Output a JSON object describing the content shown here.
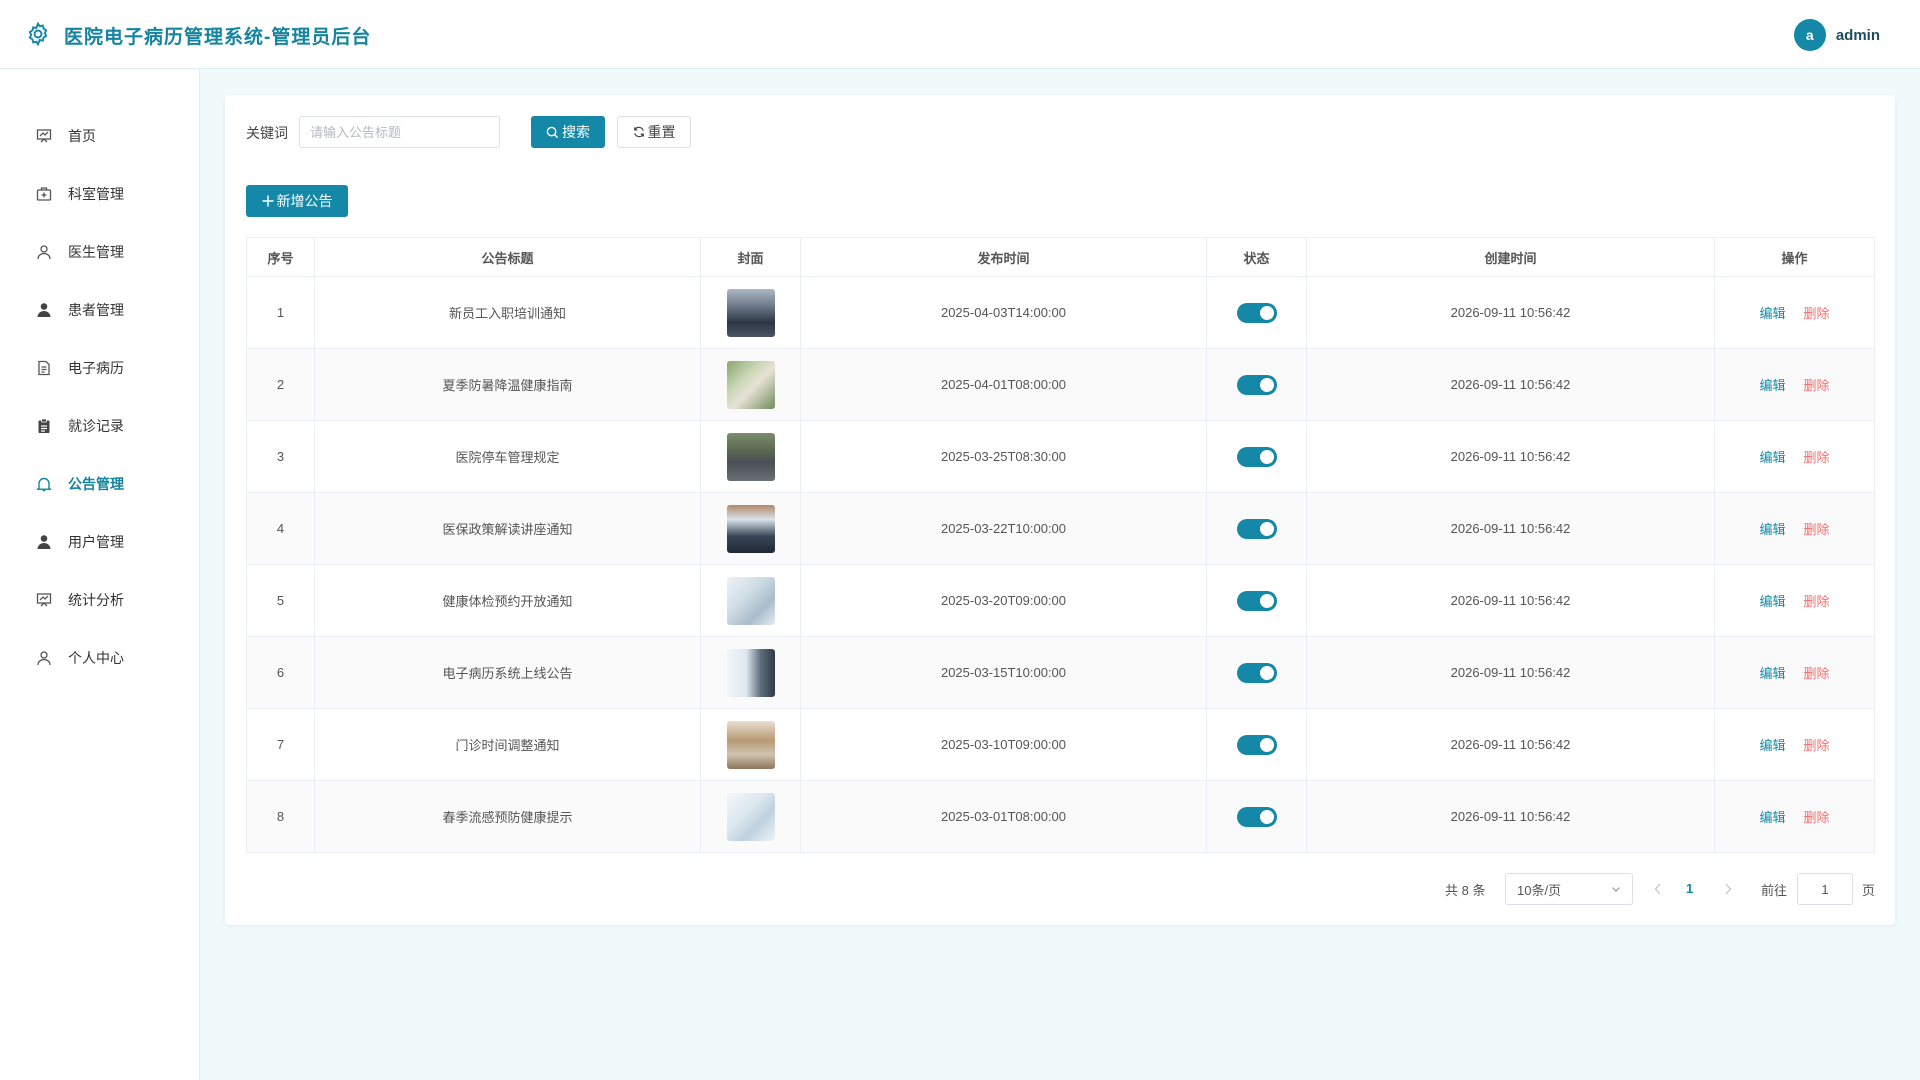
{
  "app": {
    "title": "医院电子病历管理系统-管理员后台"
  },
  "user": {
    "avatar_letter": "a",
    "name": "admin"
  },
  "colors": {
    "primary": "#1488a6",
    "danger": "#f56c6c",
    "background": "#f0fafb"
  },
  "sidebar": {
    "items": [
      {
        "label": "首页",
        "icon": "presentation-icon",
        "active": false
      },
      {
        "label": "科室管理",
        "icon": "medical-kit-icon",
        "active": false
      },
      {
        "label": "医生管理",
        "icon": "user-outline-icon",
        "active": false
      },
      {
        "label": "患者管理",
        "icon": "user-filled-icon",
        "active": false
      },
      {
        "label": "电子病历",
        "icon": "document-icon",
        "active": false
      },
      {
        "label": "就诊记录",
        "icon": "clipboard-icon",
        "active": false
      },
      {
        "label": "公告管理",
        "icon": "bell-icon",
        "active": true
      },
      {
        "label": "用户管理",
        "icon": "user-filled-icon",
        "active": false
      },
      {
        "label": "统计分析",
        "icon": "presentation-icon",
        "active": false
      },
      {
        "label": "个人中心",
        "icon": "user-outline-icon",
        "active": false
      }
    ]
  },
  "search": {
    "label": "关键词",
    "placeholder": "请输入公告标题",
    "value": "",
    "search_label": "搜索",
    "reset_label": "重置"
  },
  "toolbar": {
    "add_label": "新增公告"
  },
  "table": {
    "columns": [
      "序号",
      "公告标题",
      "封面",
      "发布时间",
      "状态",
      "创建时间",
      "操作"
    ],
    "edit_label": "编辑",
    "delete_label": "删除",
    "rows": [
      {
        "index": "1",
        "title": "新员工入职培训通知",
        "cover": "training-room-photo",
        "publish_time": "2025-04-03T14:00:00",
        "enabled": true,
        "created": "2026-09-11 10:56:42"
      },
      {
        "index": "2",
        "title": "夏季防暑降温健康指南",
        "cover": "summer-drinking-photo",
        "publish_time": "2025-04-01T08:00:00",
        "enabled": true,
        "created": "2026-09-11 10:56:42"
      },
      {
        "index": "3",
        "title": "医院停车管理规定",
        "cover": "parking-lot-photo",
        "publish_time": "2025-03-25T08:30:00",
        "enabled": true,
        "created": "2026-09-11 10:56:42"
      },
      {
        "index": "4",
        "title": "医保政策解读讲座通知",
        "cover": "lecture-hall-photo",
        "publish_time": "2025-03-22T10:00:00",
        "enabled": true,
        "created": "2026-09-11 10:56:42"
      },
      {
        "index": "5",
        "title": "健康体检预约开放通知",
        "cover": "checkup-room-photo",
        "publish_time": "2025-03-20T09:00:00",
        "enabled": true,
        "created": "2026-09-11 10:56:42"
      },
      {
        "index": "6",
        "title": "电子病历系统上线公告",
        "cover": "doctor-computer-photo",
        "publish_time": "2025-03-15T10:00:00",
        "enabled": true,
        "created": "2026-09-11 10:56:42"
      },
      {
        "index": "7",
        "title": "门诊时间调整通知",
        "cover": "clinic-lobby-photo",
        "publish_time": "2025-03-10T09:00:00",
        "enabled": true,
        "created": "2026-09-11 10:56:42"
      },
      {
        "index": "8",
        "title": "春季流感预防健康提示",
        "cover": "hand-washing-photo",
        "publish_time": "2025-03-01T08:00:00",
        "enabled": true,
        "created": "2026-09-11 10:56:42"
      }
    ]
  },
  "pagination": {
    "total_text": "共 8 条",
    "page_size": "10条/页",
    "current_page": "1",
    "goto_label": "前往",
    "goto_value": "1",
    "goto_suffix": "页"
  }
}
